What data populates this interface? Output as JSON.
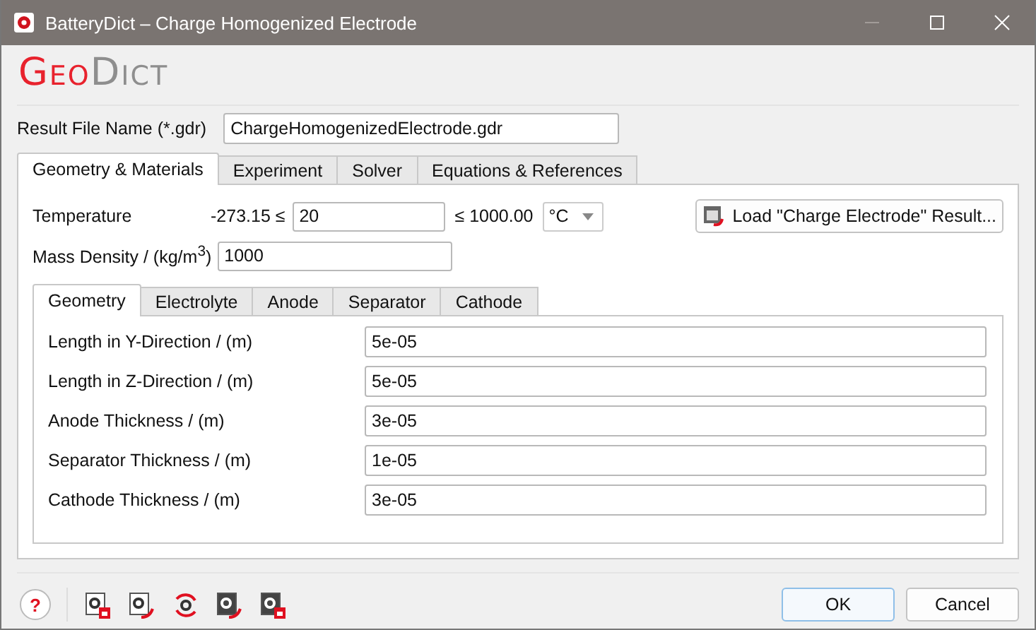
{
  "window": {
    "title": "BatteryDict – Charge Homogenized Electrode",
    "minimize_disabled": true
  },
  "logo": {
    "first": "Geo",
    "second": "Dict"
  },
  "result_file": {
    "label": "Result File Name (*.gdr)",
    "value": "ChargeHomogenizedElectrode.gdr"
  },
  "tabs": [
    {
      "label": "Geometry & Materials",
      "selected": true
    },
    {
      "label": "Experiment",
      "selected": false
    },
    {
      "label": "Solver",
      "selected": false
    },
    {
      "label": "Equations & References",
      "selected": false
    }
  ],
  "temperature": {
    "label": "Temperature",
    "min": "-273.15 ≤",
    "value": "20",
    "max": "≤ 1000.00",
    "unit": "°C"
  },
  "load_button": "Load \"Charge Electrode\" Result...",
  "mass_density": {
    "label": "Mass Density / (kg/m$^{3}$)",
    "value": "1000"
  },
  "inner_tabs": [
    {
      "label": "Geometry",
      "selected": true
    },
    {
      "label": "Electrolyte",
      "selected": false
    },
    {
      "label": "Anode",
      "selected": false
    },
    {
      "label": "Separator",
      "selected": false
    },
    {
      "label": "Cathode",
      "selected": false
    }
  ],
  "fields": [
    {
      "label": "Length in Y-Direction / (m)",
      "value": "5e-05"
    },
    {
      "label": "Length in Z-Direction / (m)",
      "value": "5e-05"
    },
    {
      "label": "Anode Thickness / (m)",
      "value": "3e-05"
    },
    {
      "label": "Separator Thickness / (m)",
      "value": "1e-05"
    },
    {
      "label": "Cathode Thickness / (m)",
      "value": "3e-05"
    }
  ],
  "help": "?",
  "buttons": [
    {
      "label": "OK",
      "kind": "default"
    },
    {
      "label": "Cancel",
      "kind": "normal"
    }
  ]
}
